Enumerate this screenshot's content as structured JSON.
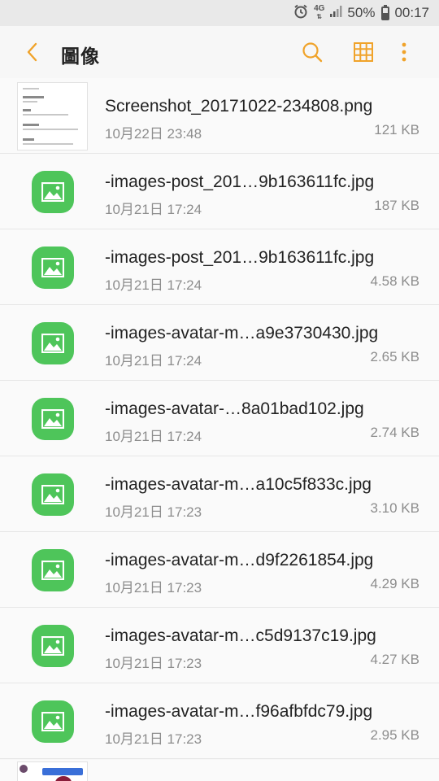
{
  "status_bar": {
    "network": "4G",
    "battery": "50%",
    "battery_level": 0.5,
    "time": "00:17"
  },
  "app_bar": {
    "title": "圖像"
  },
  "files": [
    {
      "name": "Screenshot_20171022-234808.png",
      "date": "10月22日 23:48",
      "size": "121 KB",
      "thumb": "screenshot"
    },
    {
      "name": "-images-post_201…9b163611fc.jpg",
      "date": "10月21日 17:24",
      "size": "187 KB",
      "thumb": "image-icon"
    },
    {
      "name": "-images-post_201…9b163611fc.jpg",
      "date": "10月21日 17:24",
      "size": "4.58 KB",
      "thumb": "image-icon"
    },
    {
      "name": "-images-avatar-m…a9e3730430.jpg",
      "date": "10月21日 17:24",
      "size": "2.65 KB",
      "thumb": "image-icon"
    },
    {
      "name": "-images-avatar-…8a01bad102.jpg",
      "date": "10月21日 17:24",
      "size": "2.74 KB",
      "thumb": "image-icon"
    },
    {
      "name": "-images-avatar-m…a10c5f833c.jpg",
      "date": "10月21日 17:23",
      "size": "3.10 KB",
      "thumb": "image-icon"
    },
    {
      "name": "-images-avatar-m…d9f2261854.jpg",
      "date": "10月21日 17:23",
      "size": "4.29 KB",
      "thumb": "image-icon"
    },
    {
      "name": "-images-avatar-m…c5d9137c19.jpg",
      "date": "10月21日 17:23",
      "size": "4.27 KB",
      "thumb": "image-icon"
    },
    {
      "name": "-images-avatar-m…f96afbfdc79.jpg",
      "date": "10月21日 17:23",
      "size": "2.95 KB",
      "thumb": "image-icon"
    }
  ],
  "colors": {
    "accent": "#f0a32a",
    "image_icon_bg": "#4ec55a",
    "secondary_text": "#8d8d8d"
  }
}
